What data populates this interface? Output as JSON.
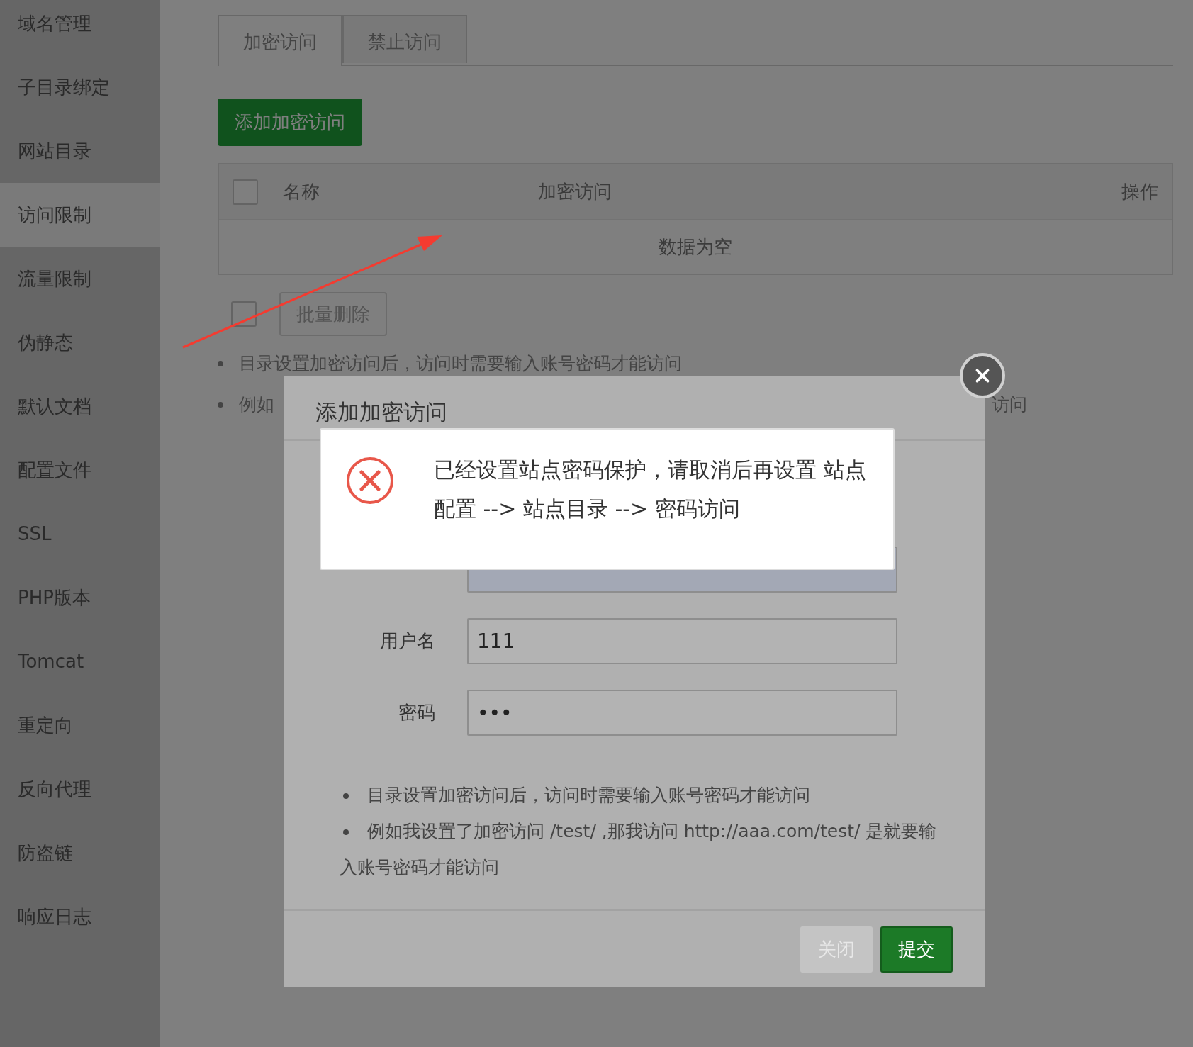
{
  "sidebar": {
    "items": [
      {
        "label": "域名管理",
        "selected": false
      },
      {
        "label": "子目录绑定",
        "selected": false
      },
      {
        "label": "网站目录",
        "selected": false
      },
      {
        "label": "访问限制",
        "selected": true
      },
      {
        "label": "流量限制",
        "selected": false
      },
      {
        "label": "伪静态",
        "selected": false
      },
      {
        "label": "默认文档",
        "selected": false
      },
      {
        "label": "配置文件",
        "selected": false
      },
      {
        "label": "SSL",
        "selected": false
      },
      {
        "label": "PHP版本",
        "selected": false
      },
      {
        "label": "Tomcat",
        "selected": false
      },
      {
        "label": "重定向",
        "selected": false
      },
      {
        "label": "反向代理",
        "selected": false
      },
      {
        "label": "防盗链",
        "selected": false
      },
      {
        "label": "响应日志",
        "selected": false
      }
    ]
  },
  "tabs": [
    {
      "label": "加密访问",
      "selected": true
    },
    {
      "label": "禁止访问",
      "selected": false
    }
  ],
  "add_button": "添加加密访问",
  "table": {
    "select_all_checked": false,
    "columns": [
      "名称",
      "加密访问",
      "操作"
    ],
    "empty_text": "数据为空"
  },
  "batch": {
    "checked": false,
    "button": "批量删除"
  },
  "notes": [
    {
      "parts": [
        "目录设置加密访问后，访问时需要输入账号密码才能访问"
      ]
    },
    {
      "parts": [
        "例如",
        "访问"
      ]
    }
  ],
  "dialog": {
    "title": "添加加密访问",
    "fields": [
      {
        "autofilled": true
      },
      {
        "label": "用户名",
        "value": "111",
        "autofilled": false
      },
      {
        "label": "密码",
        "value": "•••",
        "autofilled": false
      }
    ],
    "notes": [
      "目录设置加密访问后，访问时需要输入账号密码才能访问",
      "例如我设置了加密访问 /test/ ,那我访问 http://aaa.com/test/ 是就要输入账号密码才能访问"
    ],
    "buttons": [
      {
        "label": "关闭",
        "kind": "secondary"
      },
      {
        "label": "提交",
        "kind": "primary"
      }
    ]
  },
  "alert": {
    "kind": "error",
    "message": "已经设置站点密码保护，请取消后再设置 站点配置 --> 站点目录 --> 密码访问"
  }
}
